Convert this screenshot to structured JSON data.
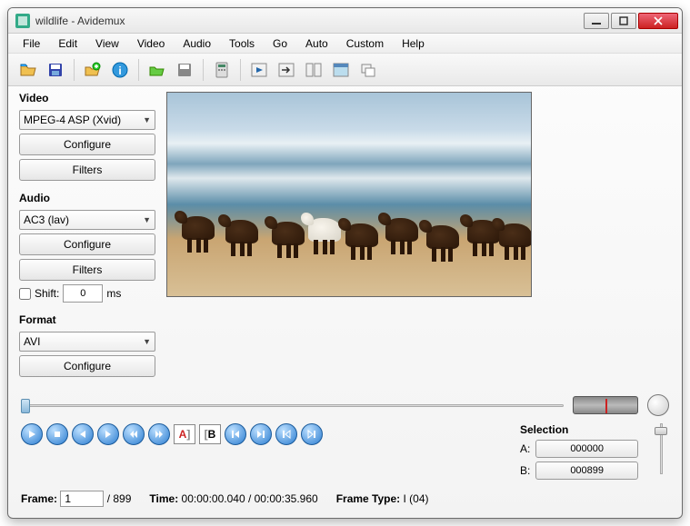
{
  "window": {
    "title": "wildlife - Avidemux"
  },
  "menu": {
    "items": [
      "File",
      "Edit",
      "View",
      "Video",
      "Audio",
      "Tools",
      "Go",
      "Auto",
      "Custom",
      "Help"
    ]
  },
  "video": {
    "label": "Video",
    "codec": "MPEG-4 ASP (Xvid)",
    "configure": "Configure",
    "filters": "Filters"
  },
  "audio": {
    "label": "Audio",
    "codec": "AC3 (lav)",
    "configure": "Configure",
    "filters": "Filters",
    "shift_label": "Shift:",
    "shift_value": "0",
    "shift_unit": "ms"
  },
  "format": {
    "label": "Format",
    "container": "AVI",
    "configure": "Configure"
  },
  "selection": {
    "label": "Selection",
    "a_label": "A:",
    "a_value": "000000",
    "b_label": "B:",
    "b_value": "000899"
  },
  "info": {
    "frame_label": "Frame:",
    "frame_value": "1",
    "frame_total": "/ 899",
    "time_label": "Time:",
    "time_value": "00:00:00.040",
    "time_total": "/ 00:00:35.960",
    "frametype_label": "Frame Type:",
    "frametype_value": "I (04)"
  }
}
